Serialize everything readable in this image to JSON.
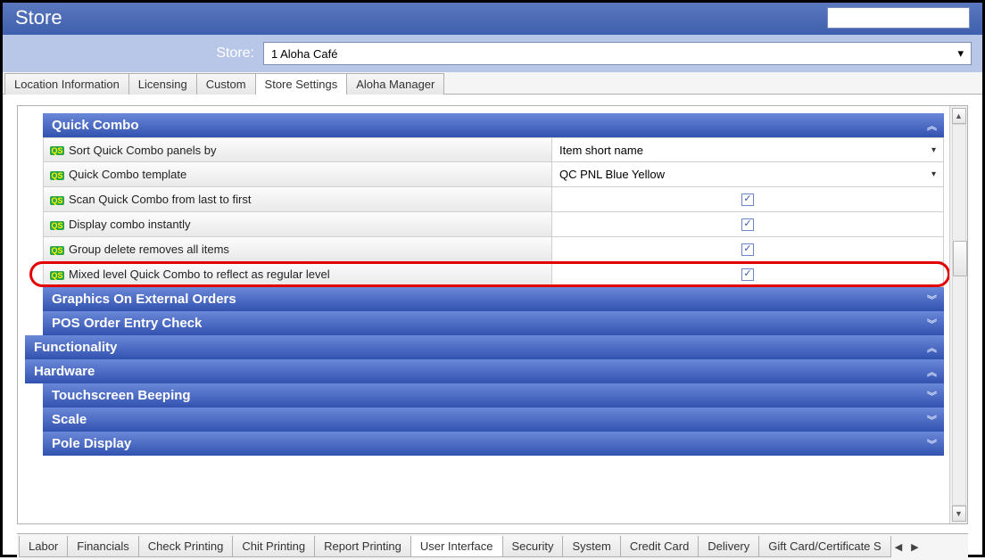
{
  "title": "Store",
  "store_bar": {
    "label": "Store:",
    "selected": "1 Aloha Café"
  },
  "tabs_top": {
    "items": [
      "Location Information",
      "Licensing",
      "Custom",
      "Store Settings",
      "Aloha Manager"
    ],
    "active_index": 3
  },
  "sections": {
    "quick_combo": "Quick Combo",
    "graphics": "Graphics On External Orders",
    "pos_order": "POS Order Entry Check",
    "functionality": "Functionality",
    "hardware": "Hardware",
    "touchscreen": "Touchscreen Beeping",
    "scale": "Scale",
    "pole": "Pole Display"
  },
  "quick_combo_rows": [
    {
      "label": "Sort Quick Combo panels by",
      "value": "Item short name",
      "type": "dropdown"
    },
    {
      "label": "Quick Combo template",
      "value": "QC PNL Blue Yellow",
      "type": "dropdown"
    },
    {
      "label": "Scan Quick Combo from last to first",
      "type": "check",
      "checked": true
    },
    {
      "label": "Display combo instantly",
      "type": "check",
      "checked": true
    },
    {
      "label": "Group delete removes all items",
      "type": "check",
      "checked": true
    },
    {
      "label": "Mixed level Quick Combo to reflect as regular level",
      "type": "check",
      "checked": true,
      "highlight": true
    }
  ],
  "tabs_bottom": {
    "items": [
      "Labor",
      "Financials",
      "Check Printing",
      "Chit Printing",
      "Report Printing",
      "User Interface",
      "Security",
      "System",
      "Credit Card",
      "Delivery",
      "Gift Card/Certificate S"
    ],
    "active_index": 5
  }
}
